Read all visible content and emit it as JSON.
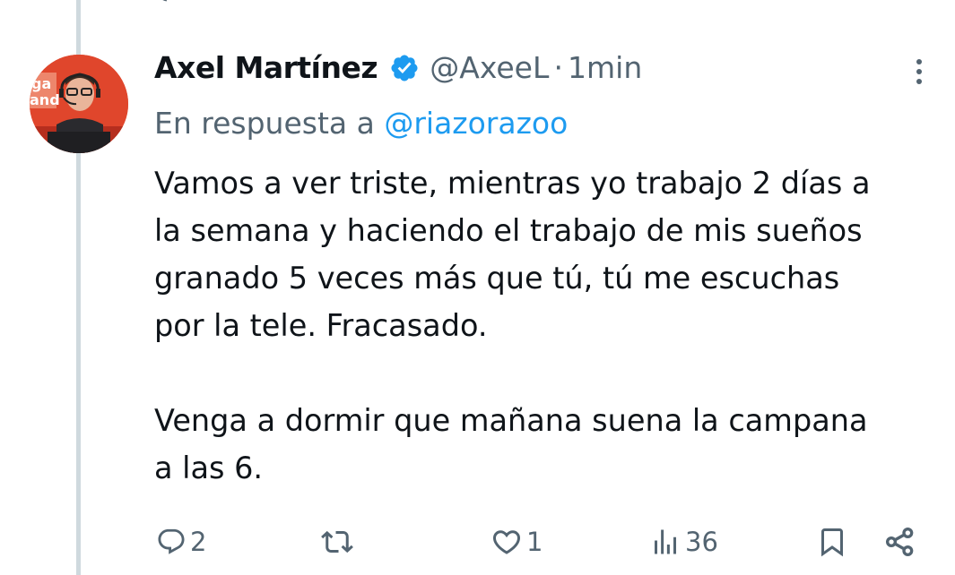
{
  "tweet": {
    "author": {
      "display_name": "Axel Martínez",
      "handle": "@AxeeL",
      "verified": true,
      "avatar_icon": "person-avatar",
      "avatar_logo_text": "ga\nand"
    },
    "separator": "·",
    "timestamp": "1min",
    "reply_prefix": "En respuesta a",
    "reply_to": "@riazorazoo",
    "paragraphs": [
      "Vamos a ver triste, mientras yo trabajo 2 días a\nla semana y haciendo el trabajo de mis sueños\ngranado 5 veces más que tú, tú me escuchas\npor la tele. Fracasado.",
      "Venga a dormir que mañana suena la campana\na las 6."
    ],
    "actions": {
      "reply_count": "2",
      "retweet_count": "",
      "like_count": "1",
      "views_count": "36"
    }
  },
  "colors": {
    "text": "#0f1419",
    "secondary": "#536471",
    "accent": "#1d9bf0",
    "thread_line": "#cfd9de"
  }
}
